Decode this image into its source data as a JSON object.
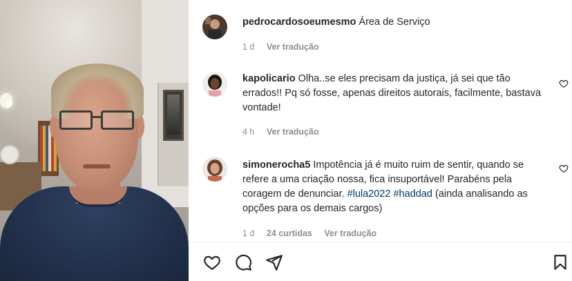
{
  "comments": [
    {
      "username": "pedrocardosoeumesmo",
      "text": "Área de Serviço",
      "time": "1 d",
      "translate": "Ver tradução"
    },
    {
      "username": "kapolicario",
      "text": "Olha..se eles precisam da justiça, já sei que tão errados!! Pq só fosse, apenas direitos autorais, facilmente, bastava vontade!",
      "time": "4 h",
      "translate": "Ver tradução"
    },
    {
      "username": "simonerocha5",
      "text_before": "Impotência já é muito ruim de sentir, quando se refere a uma criação nossa, fica insuportável! Parabéns pela coragem de denunciar. ",
      "hashtag1": "#lula2022",
      "hashtag2": "#haddad",
      "text_after": "(ainda analisando as opções para os demais cargos)",
      "time": "1 d",
      "likes": "24 curtidas",
      "translate": "Ver tradução"
    }
  ],
  "icons": {
    "like": "heart-icon",
    "comment": "comment-icon",
    "share": "paper-plane-icon",
    "save": "bookmark-icon",
    "comment_like": "small-heart-icon"
  },
  "colors": {
    "text": "#262626",
    "meta": "#8e8e8e",
    "hashtag": "#00376b"
  }
}
